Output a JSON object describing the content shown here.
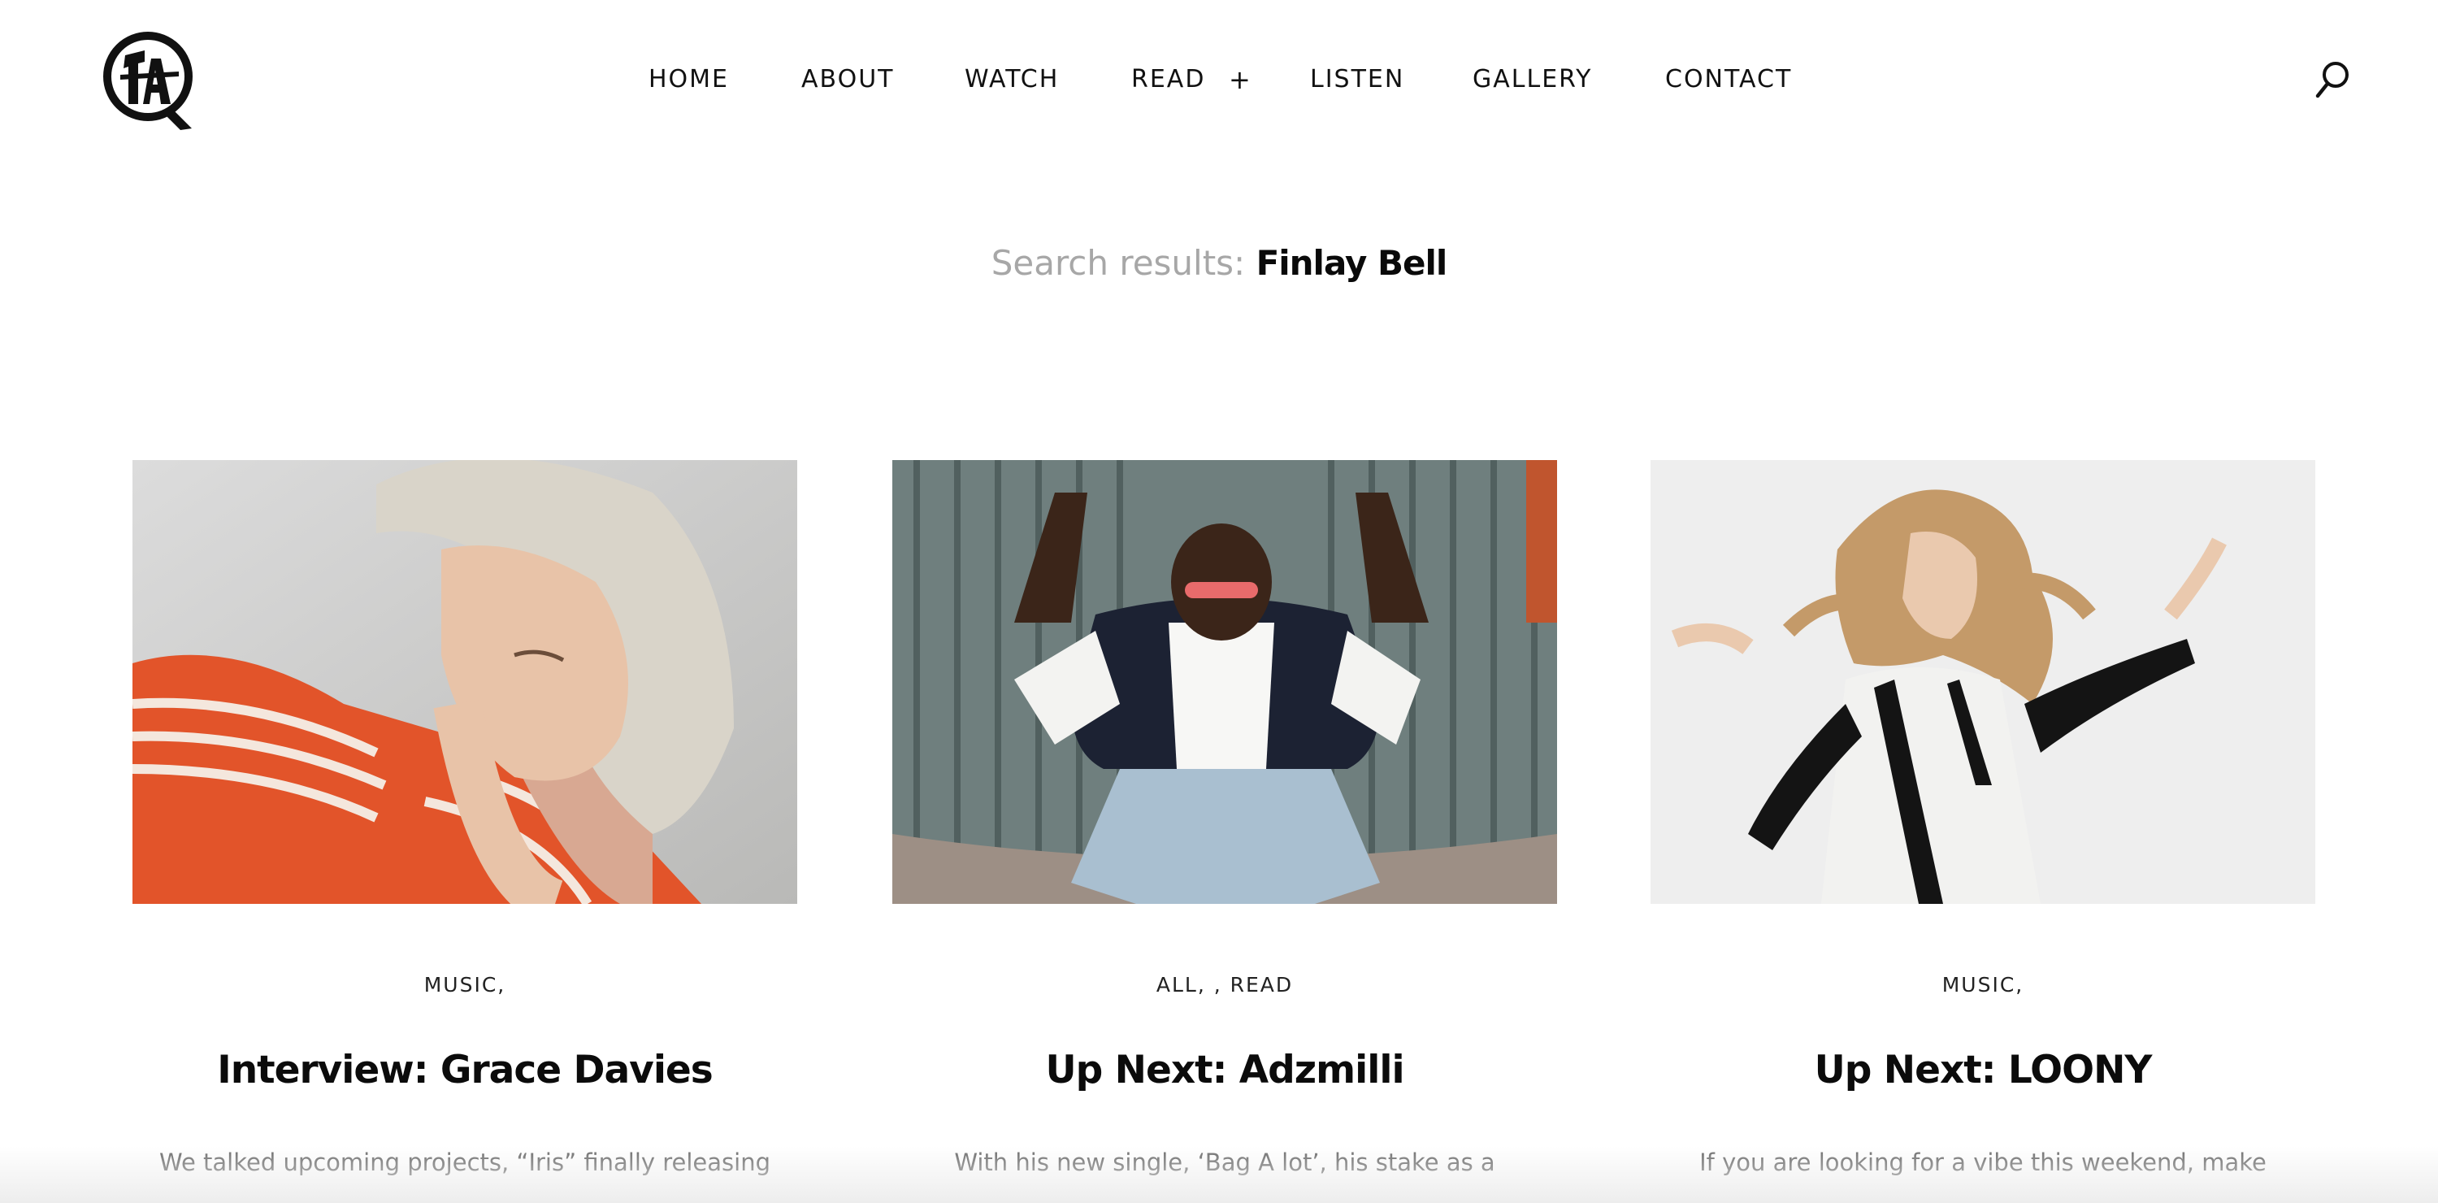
{
  "header": {
    "logo_alt": "site logo",
    "nav": [
      {
        "label": "HOME"
      },
      {
        "label": "ABOUT"
      },
      {
        "label": "WATCH"
      },
      {
        "label": "READ",
        "expander": "+"
      },
      {
        "label": "LISTEN"
      },
      {
        "label": "GALLERY"
      },
      {
        "label": "CONTACT"
      }
    ],
    "search_icon": "search-icon"
  },
  "results": {
    "label": "Search results:",
    "query": "Finlay Bell"
  },
  "posts": [
    {
      "categories": "MUSIC,",
      "title": "Interview: Grace Davies",
      "excerpt": "We talked upcoming projects, “Iris” finally releasing"
    },
    {
      "categories": "ALL, , READ",
      "title": "Up Next: Adzmilli",
      "excerpt": "With his new single, ‘Bag A lot’, his stake as a"
    },
    {
      "categories": "MUSIC,",
      "title": "Up Next: LOONY",
      "excerpt": "If you are looking for a vibe this weekend, make"
    }
  ],
  "colors": {
    "text": "#111111",
    "muted": "#a7a7a7",
    "excerpt": "#6b6b6b",
    "accent_orange": "#e2542a"
  }
}
